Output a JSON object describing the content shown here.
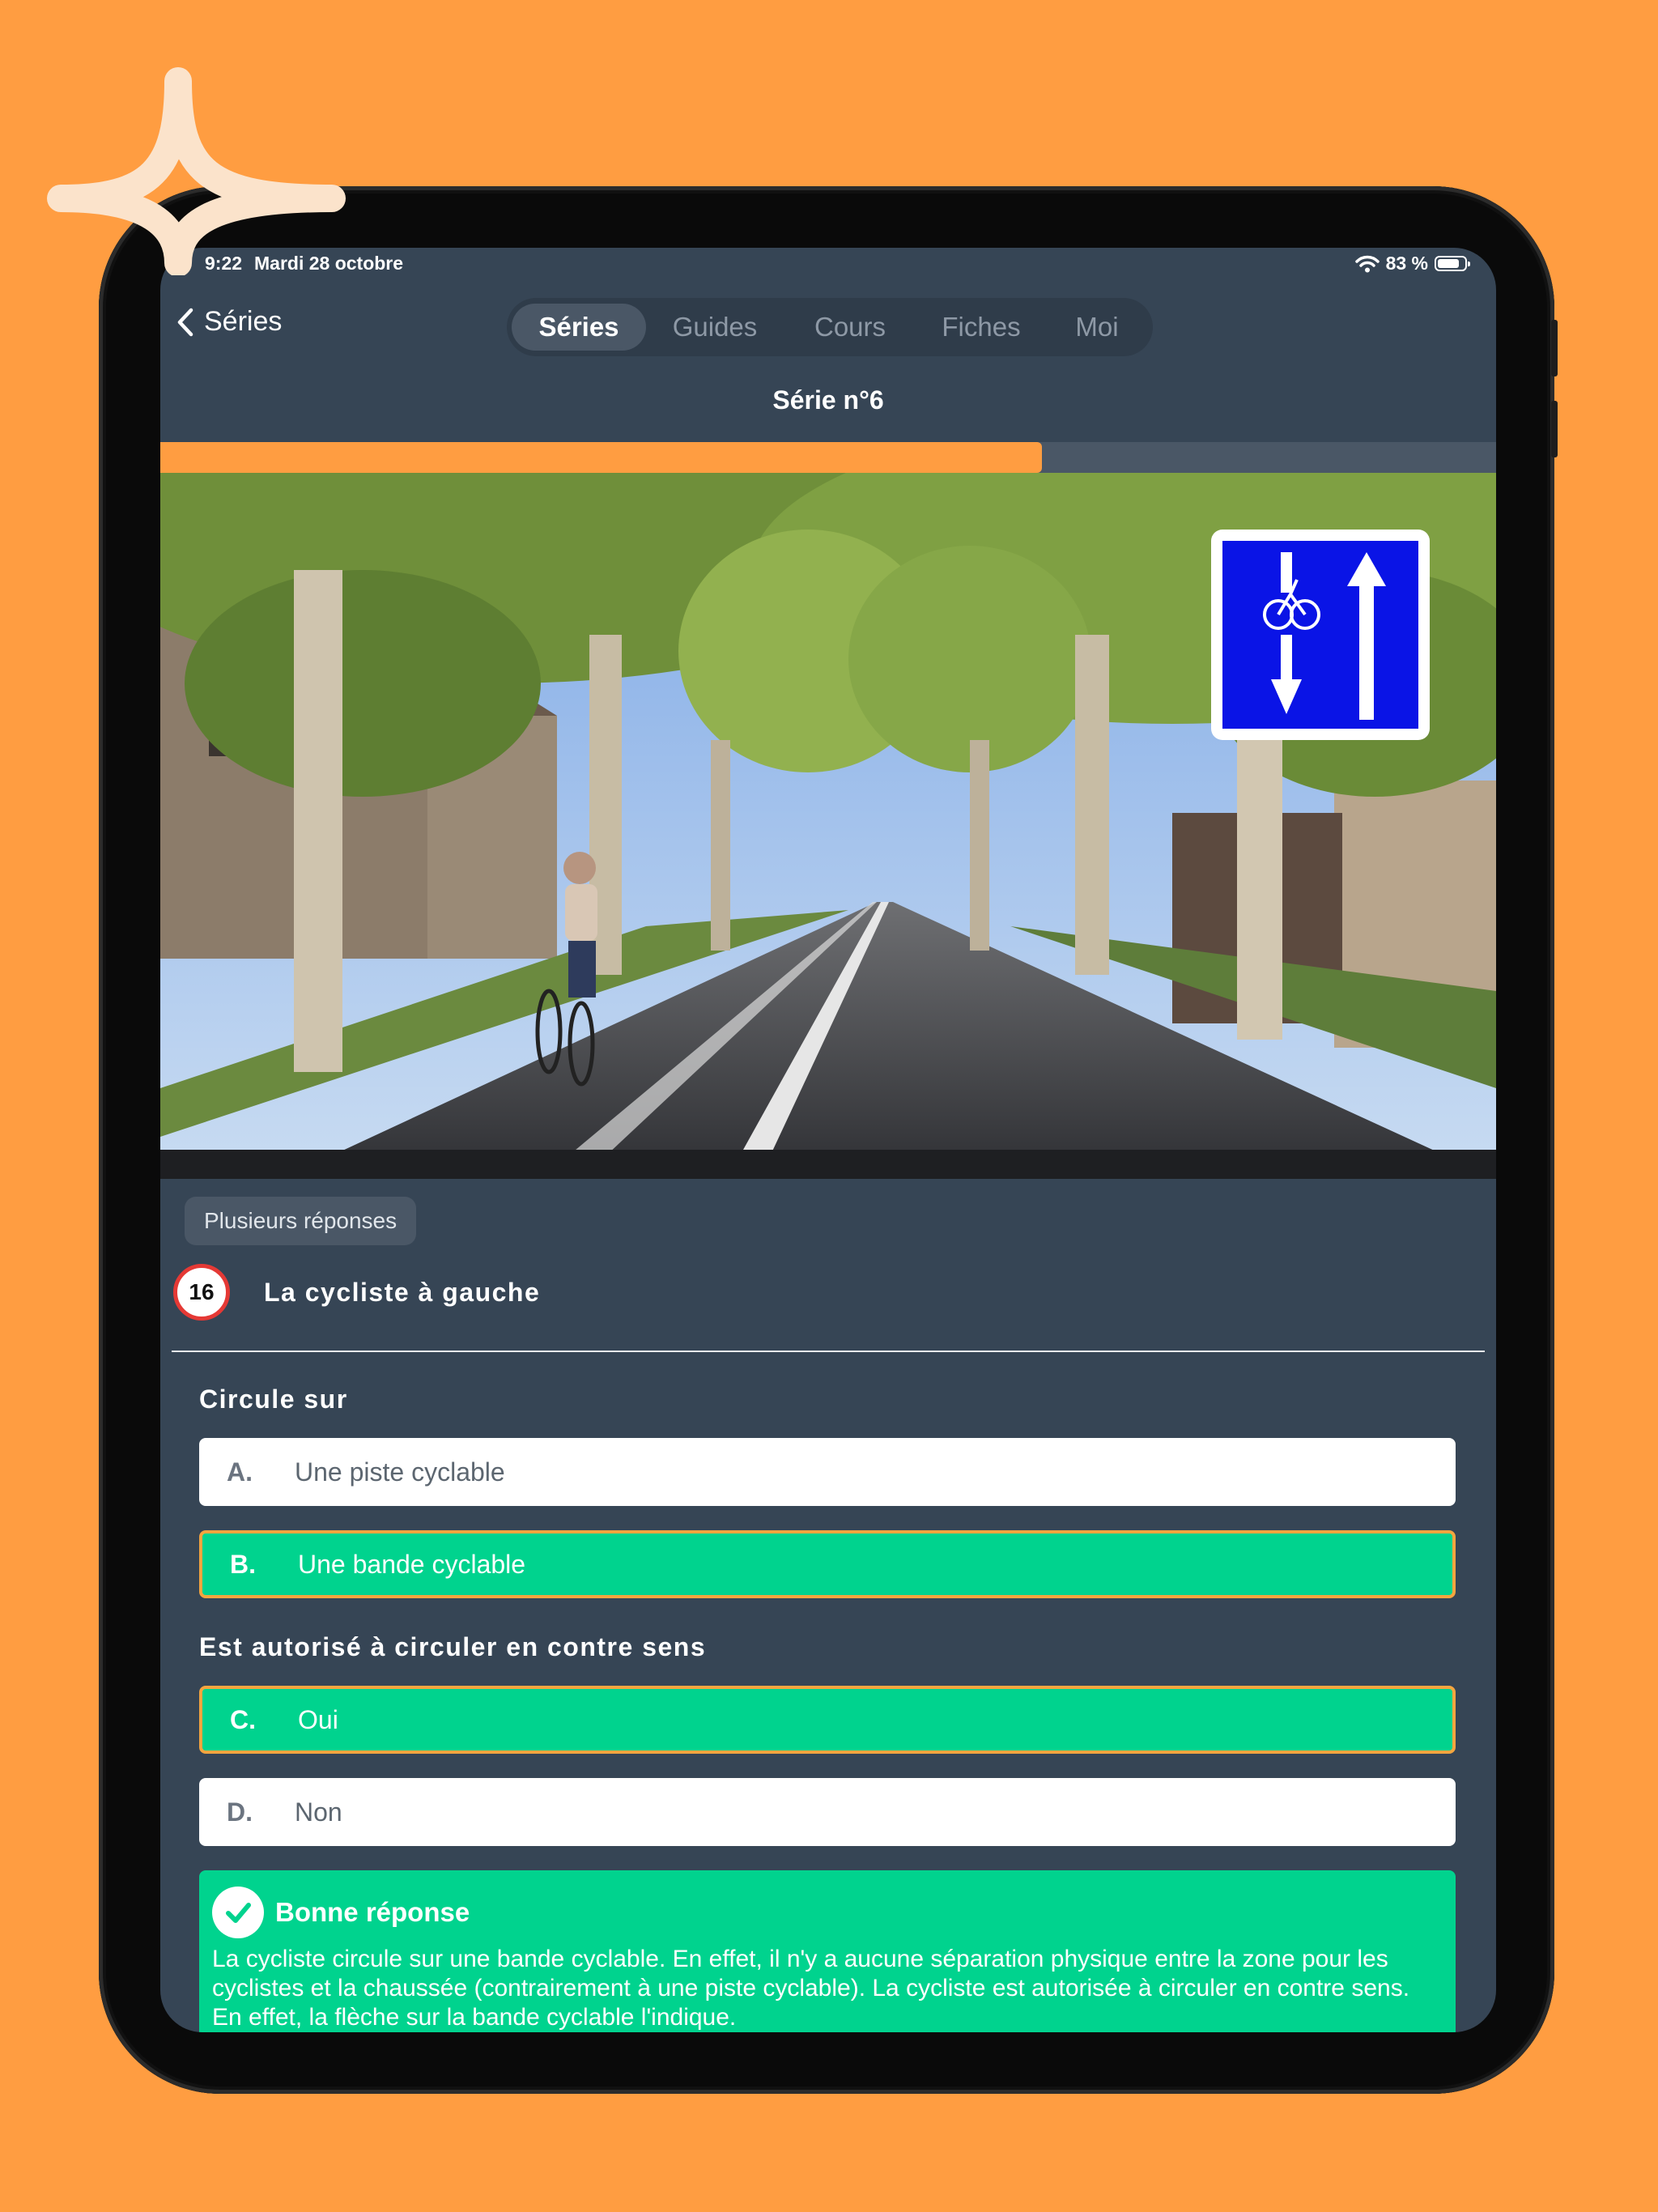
{
  "status_bar": {
    "time": "9:22",
    "date": "Mardi 28 octobre",
    "battery": "83 %",
    "battery_level": 0.83
  },
  "nav": {
    "back_label": "Séries",
    "tabs": [
      {
        "label": "Séries",
        "active": true
      },
      {
        "label": "Guides",
        "active": false
      },
      {
        "label": "Cours",
        "active": false
      },
      {
        "label": "Fiches",
        "active": false
      },
      {
        "label": "Moi",
        "active": false
      }
    ],
    "title": "Série n°6"
  },
  "progress": {
    "value": 0.66,
    "color": "#FF9D41"
  },
  "question": {
    "type_badge": "Plusieurs réponses",
    "number": "16",
    "title": "La cycliste à gauche",
    "groups": [
      {
        "subtitle": "Circule sur",
        "answers": [
          {
            "letter": "A.",
            "text": "Une piste cyclable",
            "selected": false
          },
          {
            "letter": "B.",
            "text": "Une bande cyclable",
            "selected": true
          }
        ]
      },
      {
        "subtitle": "Est autorisé à circuler en contre sens",
        "answers": [
          {
            "letter": "C.",
            "text": "Oui",
            "selected": true
          },
          {
            "letter": "D.",
            "text": "Non",
            "selected": false
          }
        ]
      }
    ]
  },
  "result": {
    "label": "Bonne réponse",
    "explanation": "La cycliste circule sur une bande cyclable. En effet, il n'y a aucune séparation physique entre la zone pour les cyclistes et la chaussée (contrairement à une piste cyclable). La cycliste est autorisée à circuler en contre sens. En effet, la flèche sur la bande cyclable l'indique."
  },
  "colors": {
    "background": "#FF9D41",
    "panel": "#364555",
    "correct": "#00D38E",
    "selected_border": "#F4A53F",
    "number_ring": "#E53935"
  }
}
